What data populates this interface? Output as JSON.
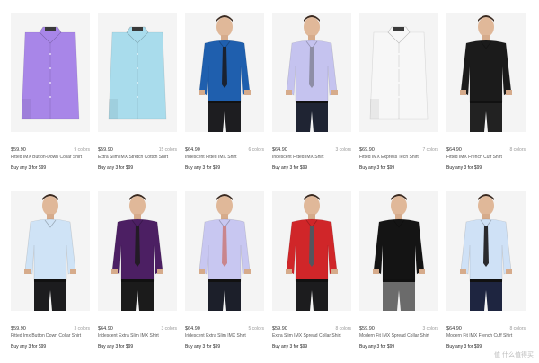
{
  "products": [
    {
      "price": "$59.90",
      "colors": "9 colors",
      "name": "Fitted IMX Button-Down Collar Shirt",
      "promo": "Buy any 3 for $99",
      "shirt": "#a886e8",
      "tie": "",
      "pants": "",
      "model": false
    },
    {
      "price": "$59.90",
      "colors": "15 colors",
      "name": "Extra Slim IMX Stretch Cotton Shirt",
      "promo": "Buy any 3 for $99",
      "shirt": "#a9dcec",
      "tie": "",
      "pants": "",
      "model": false
    },
    {
      "price": "$64.90",
      "colors": "6 colors",
      "name": "Iridescent Fitted IMX Shirt",
      "promo": "Buy any 3 for $99",
      "shirt": "#1f5fae",
      "tie": "#1a2230",
      "pants": "#1d1d20",
      "model": true
    },
    {
      "price": "$64.90",
      "colors": "3 colors",
      "name": "Iridescent Fitted IMX Shirt",
      "promo": "Buy any 3 for $99",
      "shirt": "#c5c3ef",
      "tie": "#8e8ea6",
      "pants": "#1f2433",
      "model": true
    },
    {
      "price": "$69.90",
      "colors": "7 colors",
      "name": "Fitted IMX Express Tech Shirt",
      "promo": "Buy any 3 for $99",
      "shirt": "#f7f7f7",
      "tie": "",
      "pants": "",
      "model": false
    },
    {
      "price": "$64.90",
      "colors": "8 colors",
      "name": "Fitted IMX French Cuff Shirt",
      "promo": "Buy any 3 for $99",
      "shirt": "#1b1b1b",
      "tie": "",
      "pants": "#222222",
      "model": true
    },
    {
      "price": "$59.90",
      "colors": "3 colors",
      "name": "Fitted Imx Button Down Collar Shirt",
      "promo": "Buy any 3 for $99",
      "shirt": "#cfe3f6",
      "tie": "",
      "pants": "#1c1c1e",
      "model": true
    },
    {
      "price": "$64.90",
      "colors": "3 colors",
      "name": "Iridescent Extra Slim IMX Shirt",
      "promo": "Buy any 3 for $99",
      "shirt": "#4c1f63",
      "tie": "#231b26",
      "pants": "#1b1b1b",
      "model": true
    },
    {
      "price": "$64.90",
      "colors": "5 colors",
      "name": "Iridescent Extra Slim IMX Shirt",
      "promo": "Buy any 3 for $99",
      "shirt": "#c8c7f1",
      "tie": "#c9868d",
      "pants": "#1c1f2a",
      "model": true
    },
    {
      "price": "$59.90",
      "colors": "8 colors",
      "name": "Extra Slim IMX Spread Collar Shirt",
      "promo": "Buy any 3 for $99",
      "shirt": "#d02629",
      "tie": "#55555d",
      "pants": "#1c1c1e",
      "model": true
    },
    {
      "price": "$59.90",
      "colors": "3 colors",
      "name": "Modern Fit IMX Spread Collar Shirt",
      "promo": "Buy any 3 for $99",
      "shirt": "#141414",
      "tie": "",
      "pants": "#6b6b6b",
      "model": true
    },
    {
      "price": "$64.90",
      "colors": "8 colors",
      "name": "Modern Fit IMX French Cuff Shirt",
      "promo": "Buy any 3 for $99",
      "shirt": "#cfe1f6",
      "tie": "#2a2a2e",
      "pants": "#1e2540",
      "model": true
    }
  ],
  "watermark": "值 什么值得买"
}
